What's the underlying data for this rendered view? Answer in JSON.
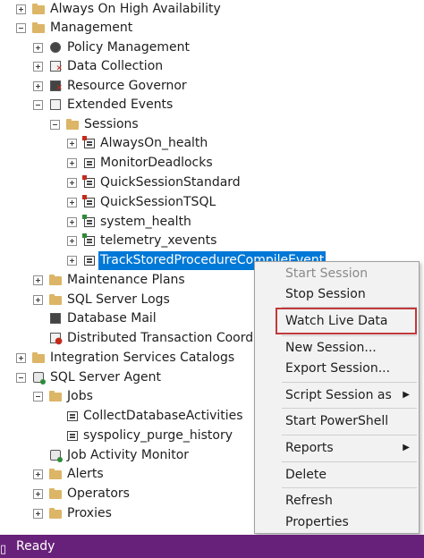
{
  "tree": {
    "nodes": [
      {
        "label": "Always On High Availability",
        "icon": "folder-icon"
      },
      {
        "label": "Management",
        "icon": "folder-icon"
      },
      {
        "label": "Policy Management",
        "icon": "policy-icon"
      },
      {
        "label": "Data Collection",
        "icon": "data-collection-icon"
      },
      {
        "label": "Resource Governor",
        "icon": "resource-governor-icon"
      },
      {
        "label": "Extended Events",
        "icon": "extended-events-icon"
      },
      {
        "label": "Sessions",
        "icon": "folder-icon"
      },
      {
        "label": "AlwaysOn_health",
        "icon": "session-stopped-icon"
      },
      {
        "label": "MonitorDeadlocks",
        "icon": "session-icon"
      },
      {
        "label": "QuickSessionStandard",
        "icon": "session-stopped-icon"
      },
      {
        "label": "QuickSessionTSQL",
        "icon": "session-stopped-icon"
      },
      {
        "label": "system_health",
        "icon": "session-running-icon"
      },
      {
        "label": "telemetry_xevents",
        "icon": "session-running-icon"
      },
      {
        "label": "TrackStoredProcedureCompileEvent",
        "icon": "session-icon",
        "selected": true
      },
      {
        "label": "Maintenance Plans",
        "icon": "folder-icon"
      },
      {
        "label": "SQL Server Logs",
        "icon": "folder-icon"
      },
      {
        "label": "Database Mail",
        "icon": "database-mail-icon"
      },
      {
        "label": "Distributed Transaction Coordin",
        "icon": "dtc-icon"
      },
      {
        "label": "Integration Services Catalogs",
        "icon": "folder-icon"
      },
      {
        "label": "SQL Server Agent",
        "icon": "sql-agent-icon"
      },
      {
        "label": "Jobs",
        "icon": "folder-icon"
      },
      {
        "label": "CollectDatabaseActivities",
        "icon": "job-icon"
      },
      {
        "label": "syspolicy_purge_history",
        "icon": "job-icon"
      },
      {
        "label": "Job Activity Monitor",
        "icon": "job-activity-icon"
      },
      {
        "label": "Alerts",
        "icon": "folder-icon"
      },
      {
        "label": "Operators",
        "icon": "folder-icon"
      },
      {
        "label": "Proxies",
        "icon": "folder-icon"
      }
    ]
  },
  "context_menu": {
    "items": [
      {
        "label": "Start Session",
        "disabled": true
      },
      {
        "label": "Stop Session"
      },
      {
        "label": "Watch Live Data",
        "highlighted": true
      },
      {
        "label": "New Session..."
      },
      {
        "label": "Export Session..."
      },
      {
        "label": "Script Session as",
        "submenu": true
      },
      {
        "label": "Start PowerShell"
      },
      {
        "label": "Reports",
        "submenu": true
      },
      {
        "label": "Delete"
      },
      {
        "label": "Refresh"
      },
      {
        "label": "Properties"
      }
    ],
    "submenu_arrow": "▶",
    "highlight_color": "#c0393b"
  },
  "status_bar": {
    "text": "Ready",
    "icon": "status-icon",
    "color": "#68217a"
  },
  "colors": {
    "selection": "#0078d7",
    "folder": "#dcb567"
  }
}
